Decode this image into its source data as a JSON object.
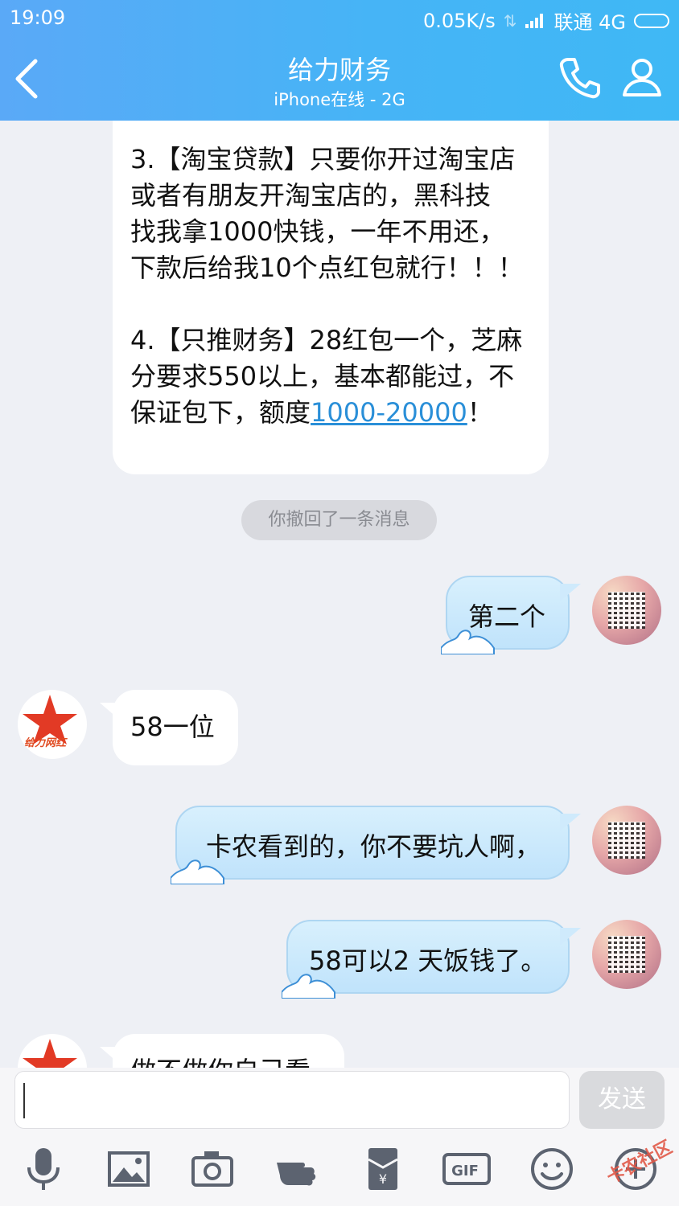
{
  "status_bar": {
    "time": "19:09",
    "speed": "0.05K/s",
    "carrier": "联通 4G"
  },
  "header": {
    "title": "给力财务",
    "subtitle": "iPhone在线 - 2G"
  },
  "messages": {
    "block_p3": {
      "line1": "3.【淘宝贷款】只要你开过淘宝店",
      "line2": "或者有朋友开淘宝店的，黑科技",
      "line3": "找我拿1000快钱，一年不用还，",
      "line4": "下款后给我10个点红包就行！！！"
    },
    "block_p4": {
      "line1": "4.【只推财务】28红包一个，芝麻",
      "line2": "分要求550以上，基本都能过，不",
      "line3_pre": "保证包下，额度",
      "line3_link": "1000-20000",
      "line3_post": "！"
    },
    "recall_notice": "你撤回了一条消息",
    "out_1": "第二个",
    "in_1": "58一位",
    "out_2": "卡农看到的，你不要坑人啊，",
    "out_3": "58可以2 天饭钱了。",
    "in_2_partial": "做不做你自己看",
    "other_avatar_caption": "给力网红"
  },
  "input": {
    "value": "",
    "send_label": "发送"
  },
  "toolbar": {
    "gif_label": "GIF",
    "watermark": "卡农社区"
  },
  "colors": {
    "header_gradient_start": "#5aa9f7",
    "header_gradient_end": "#3fb8f5",
    "chat_bg": "#eef0f5",
    "out_bubble": "#c8e8fc",
    "link": "#2a8fd8"
  }
}
